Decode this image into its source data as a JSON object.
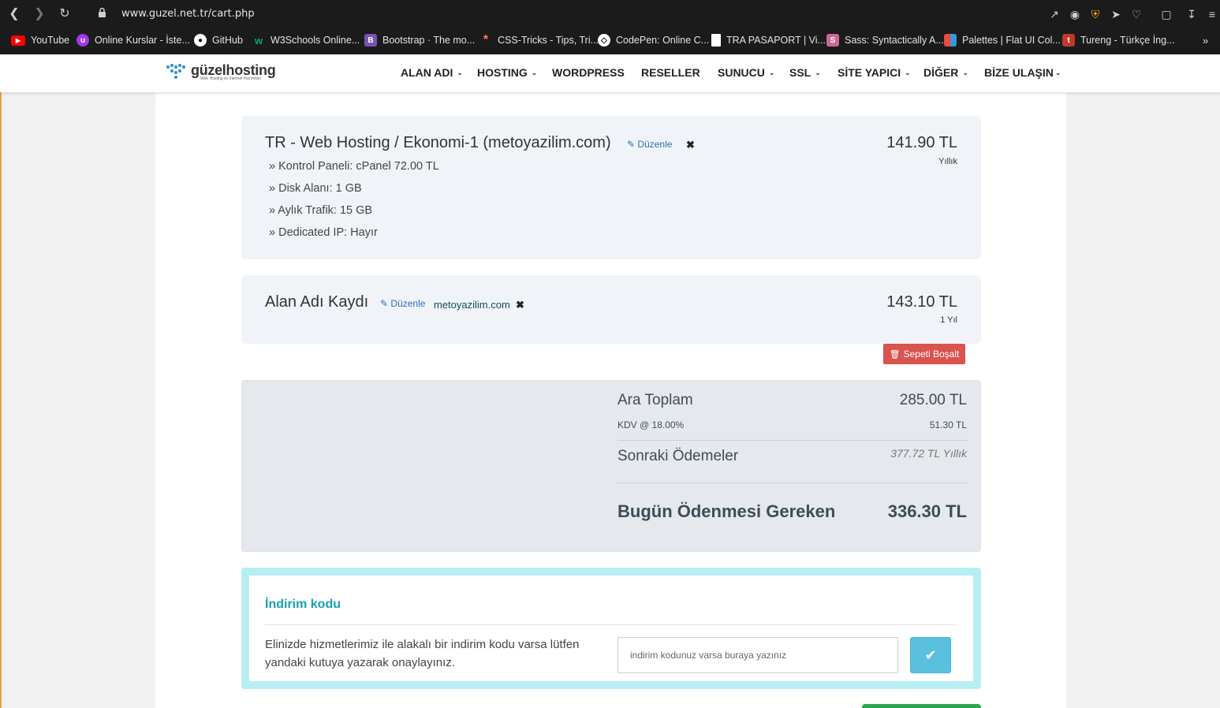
{
  "browser": {
    "url": "www.guzel.net.tr/cart.php",
    "bookmarks": [
      {
        "label": "YouTube",
        "icon": "youtube-icon",
        "color": "#ff0000"
      },
      {
        "label": "Online Kurslar - İste...",
        "icon": "udemy-icon",
        "color": "#a435f0"
      },
      {
        "label": "GitHub",
        "icon": "github-icon",
        "color": "#ffffff"
      },
      {
        "label": "W3Schools Online...",
        "icon": "w3schools-icon",
        "color": "#04aa6d"
      },
      {
        "label": "Bootstrap · The mo...",
        "icon": "bootstrap-icon",
        "color": "#7952b3"
      },
      {
        "label": "CSS-Tricks - Tips, Tri...",
        "icon": "css-tricks-icon",
        "color": "#ff7a59"
      },
      {
        "label": "CodePen: Online C...",
        "icon": "codepen-icon",
        "color": "#ffffff"
      },
      {
        "label": "TRA PASAPORT | Vi...",
        "icon": "document-icon",
        "color": "#ffffff"
      },
      {
        "label": "Sass: Syntactically A...",
        "icon": "sass-icon",
        "color": "#cd6799"
      },
      {
        "label": "Palettes | Flat UI Col...",
        "icon": "flatui-icon",
        "color": "#e74c3c"
      },
      {
        "label": "Tureng - Türkçe İng...",
        "icon": "tureng-icon",
        "color": "#c0392b"
      }
    ]
  },
  "header": {
    "logo_text": "güzelhosting",
    "logo_sub": "Web Hosting ve İnternet Hizmetleri",
    "menu": [
      "ALAN ADI",
      "HOSTING",
      "WORDPRESS",
      "RESELLER",
      "SUNUCU",
      "SSL",
      "SİTE YAPICI",
      "DİĞER",
      "BİZE ULAŞIN"
    ]
  },
  "cart": {
    "items": [
      {
        "title": "TR - Web Hosting / Ekonomi-1 (metoyazilim.com)",
        "edit": "Düzenle",
        "price": "141.90 TL",
        "cycle": "Yıllık",
        "details": [
          "» Kontrol Paneli: cPanel 72.00 TL",
          "» Disk Alanı: 1 GB",
          "» Aylık Trafik: 15 GB",
          "» Dedicated IP: Hayır"
        ]
      },
      {
        "title": "Alan Adı Kaydı",
        "edit": "Düzenle",
        "domain": "metoyazilim.com",
        "price": "143.10 TL",
        "cycle": "1 Yıl"
      }
    ],
    "empty_cart": "Sepeti Boşalt"
  },
  "summary": {
    "subtotal_label": "Ara Toplam",
    "subtotal_value": "285.00 TL",
    "tax_label": "KDV @ 18.00%",
    "tax_value": "51.30 TL",
    "recurring_label": "Sonraki Ödemeler",
    "recurring_value": "377.72 TL Yıllık",
    "total_label": "Bugün Ödenmesi Gereken",
    "total_value": "336.30 TL"
  },
  "promo": {
    "title": "İndirim kodu",
    "text": "Elinizde hizmetlerimiz ile alakalı bir indirim kodu varsa lütfen yandaki kutuya yazarak onaylayınız.",
    "placeholder": "indirim kodunuz varsa buraya yazınız"
  }
}
